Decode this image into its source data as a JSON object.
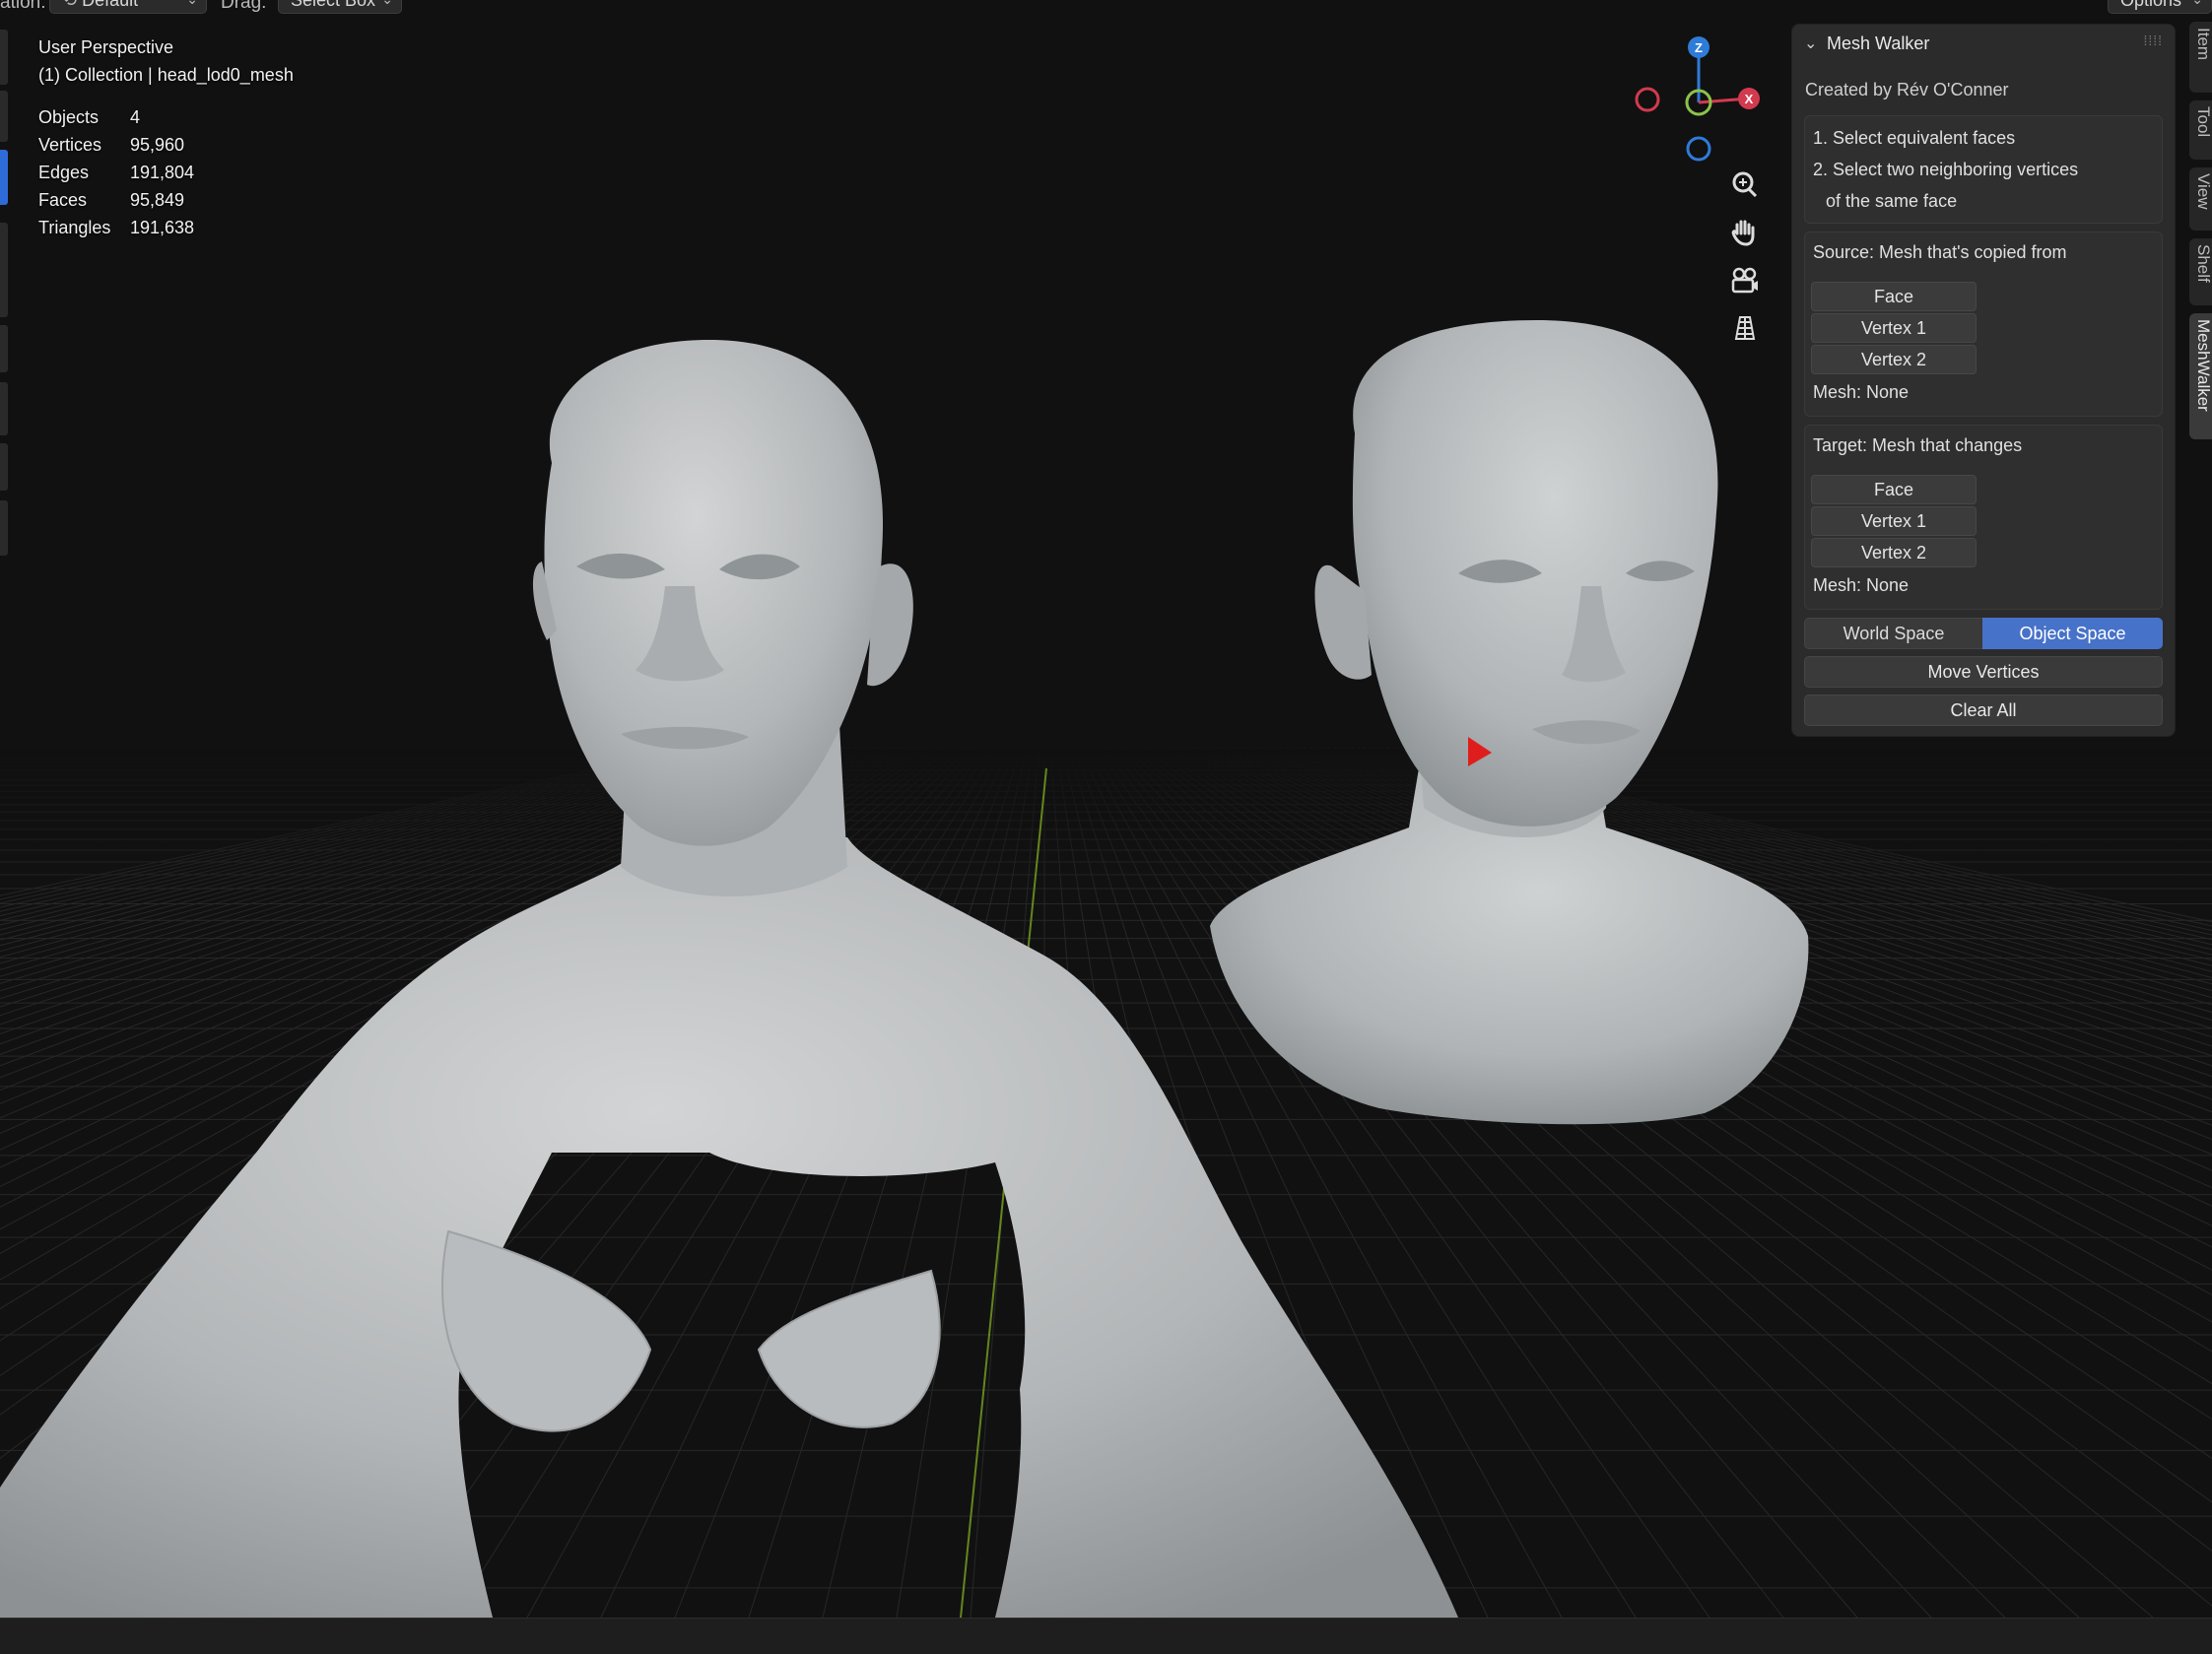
{
  "header": {
    "mode_label_fragment": "ation:",
    "orientation_value": "Default",
    "drag_label": "Drag:",
    "drag_value": "Select Box",
    "options_label": "Options"
  },
  "viewport": {
    "view_name": "User Perspective",
    "collection_line": "(1) Collection | head_lod0_mesh",
    "stats": [
      {
        "label": "Objects",
        "value": "4"
      },
      {
        "label": "Vertices",
        "value": "95,960"
      },
      {
        "label": "Edges",
        "value": "191,804"
      },
      {
        "label": "Faces",
        "value": "95,849"
      },
      {
        "label": "Triangles",
        "value": "191,638"
      }
    ],
    "gizmo": {
      "z": "Z",
      "x": "X"
    },
    "nav_icons": [
      "zoom-icon",
      "hand-pan-icon",
      "camera-icon",
      "grid-perspective-icon"
    ]
  },
  "panel": {
    "title": "Mesh Walker",
    "credit": "Created by Rév O'Conner",
    "instructions": [
      "1. Select equivalent faces",
      "2. Select two neighboring vertices",
      "of the same face"
    ],
    "source": {
      "title": "Source: Mesh that's copied from",
      "buttons": [
        "Face",
        "Vertex 1",
        "Vertex 2"
      ],
      "mesh": "Mesh: None"
    },
    "target": {
      "title": "Target: Mesh that changes",
      "buttons": [
        "Face",
        "Vertex 1",
        "Vertex 2"
      ],
      "mesh": "Mesh: None"
    },
    "space_toggle": {
      "world": "World Space",
      "object": "Object Space",
      "selected": "object"
    },
    "move_button": "Move Vertices",
    "clear_button": "Clear All"
  },
  "side_tabs": [
    "Item",
    "Tool",
    "View",
    "Shelf",
    "MeshWalker"
  ],
  "colors": {
    "accent": "#4772c9",
    "axis_x": "#d23a4f",
    "axis_y": "#8bc34a",
    "axis_z": "#2f7bd8",
    "cursor": "#e01d1d"
  }
}
